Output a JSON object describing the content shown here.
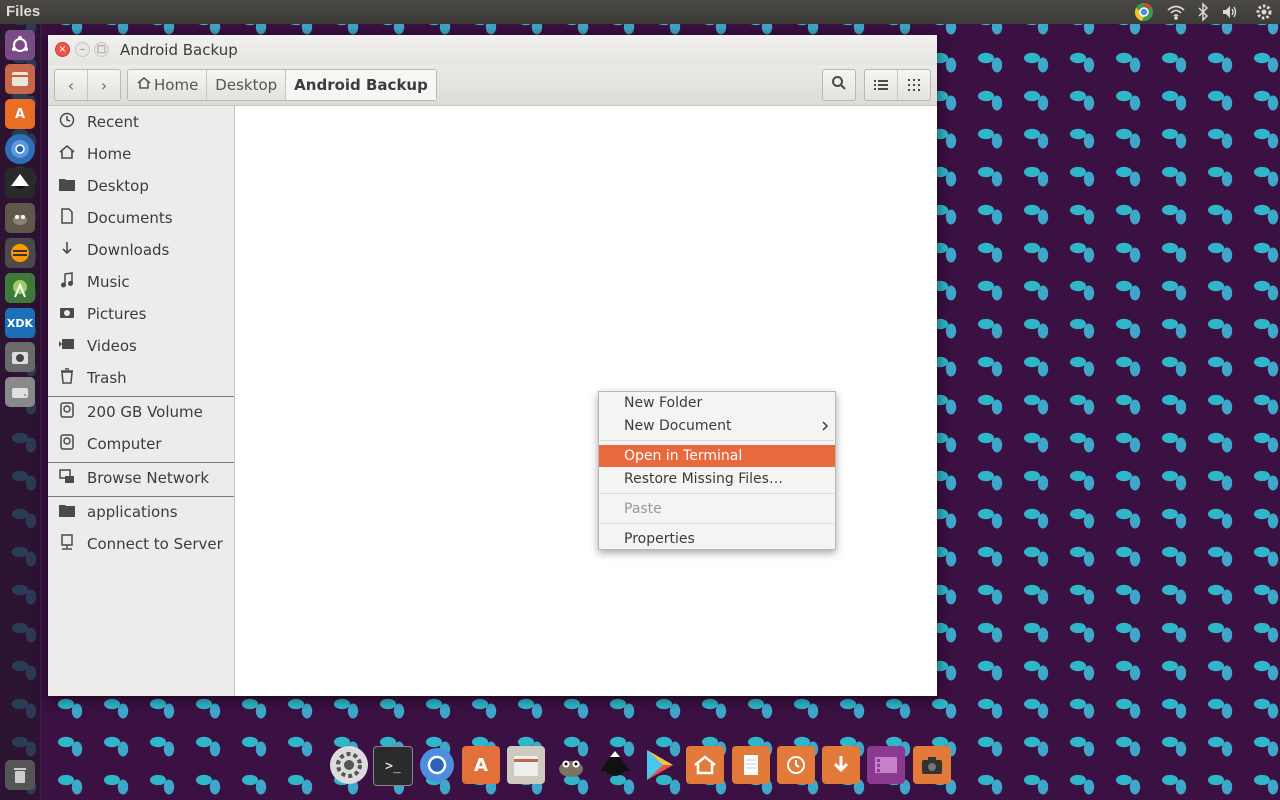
{
  "top_panel": {
    "title": "Files",
    "tray_icons": [
      "chrome-icon",
      "wifi-icon",
      "bluetooth-icon",
      "volume-icon",
      "settings-gear-icon"
    ]
  },
  "launcher": {
    "icons": [
      "ubuntu-dash-icon",
      "files-icon",
      "software-center-icon",
      "chromium-icon",
      "inkscape-icon",
      "gimp-icon",
      "sublime-icon",
      "android-studio-icon",
      "intel-xdk-icon",
      "camera-icon",
      "drive-icon",
      "trash-icon"
    ],
    "xdk_label": "XDK"
  },
  "window": {
    "title": "Android Backup",
    "toolbar": {
      "back_label": "‹",
      "forward_label": "›",
      "breadcrumbs": [
        {
          "label": "Home"
        },
        {
          "label": "Desktop"
        },
        {
          "label": "Android Backup"
        }
      ]
    }
  },
  "sidebar": {
    "places": [
      {
        "label": "Recent",
        "icon": "clock-icon"
      },
      {
        "label": "Home",
        "icon": "home-icon"
      },
      {
        "label": "Desktop",
        "icon": "folder-icon"
      },
      {
        "label": "Documents",
        "icon": "document-icon"
      },
      {
        "label": "Downloads",
        "icon": "download-icon"
      },
      {
        "label": "Music",
        "icon": "music-icon"
      },
      {
        "label": "Pictures",
        "icon": "camera-icon"
      },
      {
        "label": "Videos",
        "icon": "video-icon"
      },
      {
        "label": "Trash",
        "icon": "trash-icon"
      }
    ],
    "devices": [
      {
        "label": "200 GB Volume",
        "icon": "drive-icon"
      },
      {
        "label": "Computer",
        "icon": "drive-icon"
      }
    ],
    "network": [
      {
        "label": "Browse Network",
        "icon": "network-icon"
      }
    ],
    "bookmarks": [
      {
        "label": "applications",
        "icon": "folder-icon"
      },
      {
        "label": "Connect to Server",
        "icon": "server-icon"
      }
    ]
  },
  "context_menu": {
    "items": [
      {
        "label": "New Folder",
        "mnemonic": "F"
      },
      {
        "label": "New Document",
        "mnemonic": "D",
        "submenu": true
      },
      {
        "label": "Open in Terminal",
        "mnemonic": "e",
        "highlighted": true
      },
      {
        "label": "Restore Missing Files…"
      },
      {
        "label": "Paste",
        "disabled": true
      },
      {
        "label": "Properties",
        "mnemonic": "r"
      }
    ],
    "highlight_color": "#e9683d"
  },
  "dock": {
    "icons": [
      "ubuntu-settings-icon",
      "terminal-icon",
      "chrome-icon",
      "software-center-icon",
      "files-icon",
      "gimp-icon",
      "inkscape-icon",
      "play-store-icon",
      "home-folder-icon",
      "documents-folder-icon",
      "backup-folder-icon",
      "downloads-folder-icon",
      "videos-folder-icon",
      "camera-folder-icon"
    ],
    "terminal_glyph": ">_"
  }
}
